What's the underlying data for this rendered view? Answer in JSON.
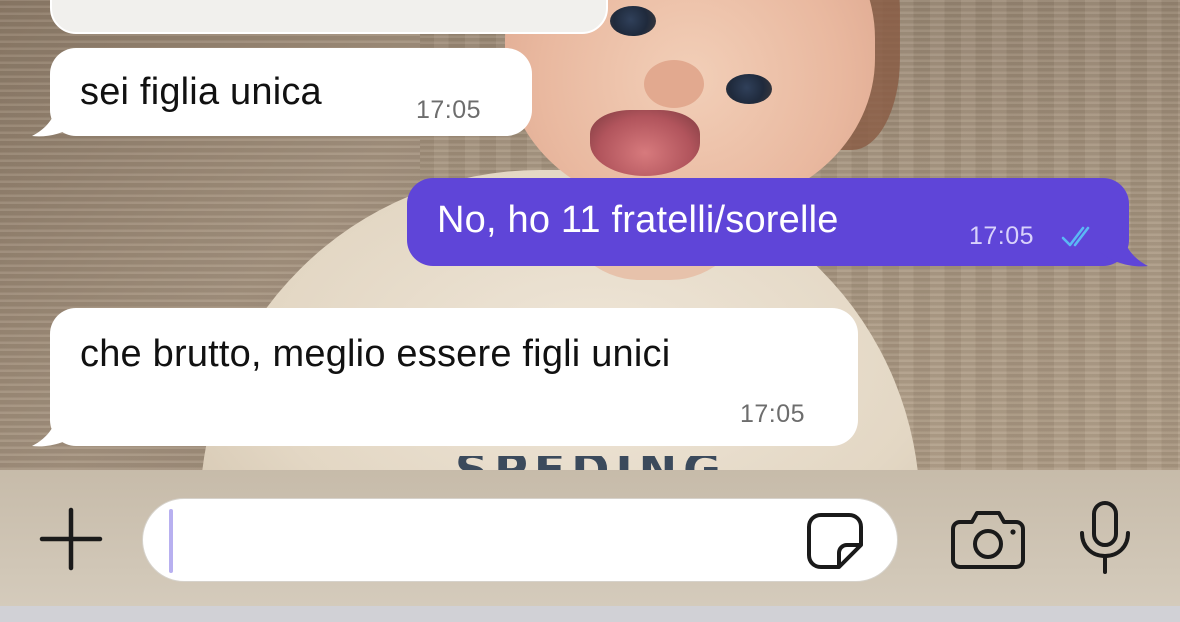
{
  "conversation": {
    "messages": [
      {
        "direction": "incoming",
        "text": "sei figlia unica",
        "time": "17:05"
      },
      {
        "direction": "outgoing",
        "text": "No, ho 11 fratelli/sorelle",
        "time": "17:05",
        "status": "read",
        "status_icon": "double-check-icon"
      },
      {
        "direction": "incoming",
        "text": "che brutto, meglio essere figli unici",
        "time": "17:05"
      }
    ]
  },
  "wallpaper": {
    "shirt_print": "SPEDING"
  },
  "composer": {
    "input_value": "",
    "add_icon": "plus-icon",
    "sticker_icon": "sticker-icon",
    "camera_icon": "camera-icon",
    "mic_icon": "microphone-icon"
  },
  "colors": {
    "outgoing_bubble": "#5f45d8",
    "incoming_bubble": "#ffffff",
    "read_ticks": "#5bb8f5",
    "composer_bar": "#d6cdbe"
  }
}
